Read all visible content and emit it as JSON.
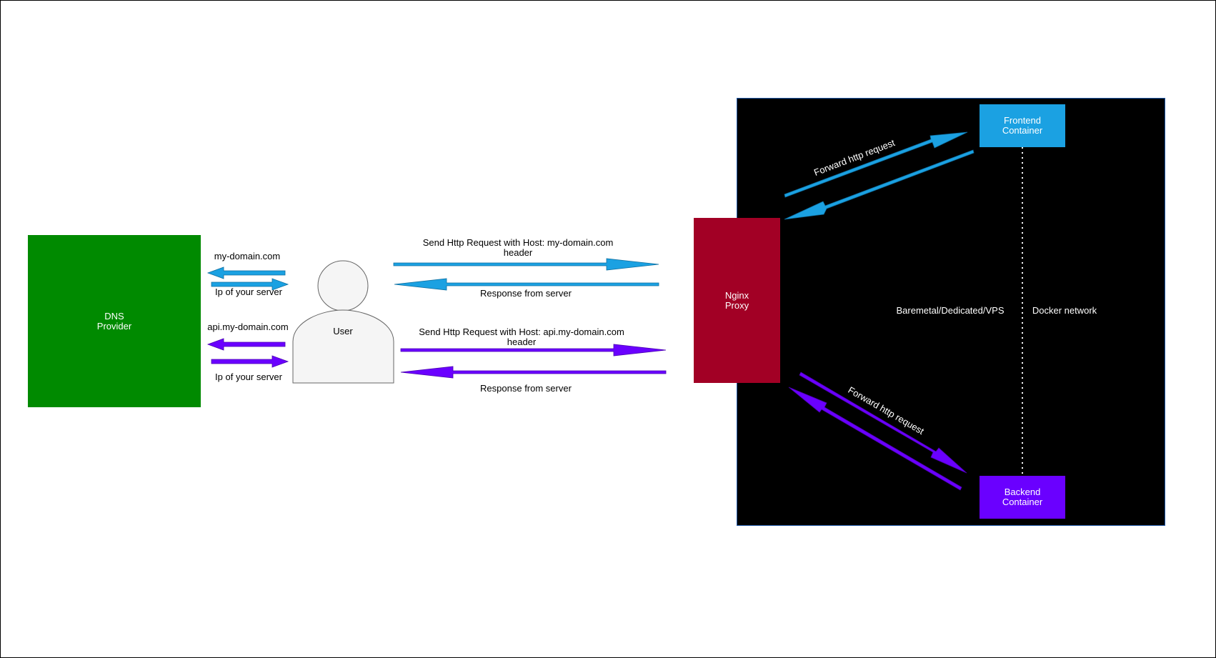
{
  "boxes": {
    "dns": "DNS\nProvider",
    "user": "User",
    "nginx": "Nginx\nProxy",
    "frontend": "Frontend\nContainer",
    "backend": "Backend\nContainer"
  },
  "labels": {
    "domain_main": "my-domain.com",
    "ip_main": "Ip of your server",
    "domain_api": "api.my-domain.com",
    "ip_api": "Ip of your server",
    "send_main": "Send Http Request with Host: my-domain.com\nheader",
    "response_main": "Response from server",
    "send_api": "Send Http Request with Host: api.my-domain.com\nheader",
    "response_api": "Response from server",
    "forward_frontend": "Forward http request",
    "forward_backend": "Forward http request",
    "baremetal": "Baremetal/Dedicated/VPS",
    "docker_network": "Docker network"
  },
  "colors": {
    "blue": "#1ba1e2",
    "purple": "#6a00ff",
    "green": "#008a00",
    "red": "#a20025",
    "black": "#000000"
  }
}
